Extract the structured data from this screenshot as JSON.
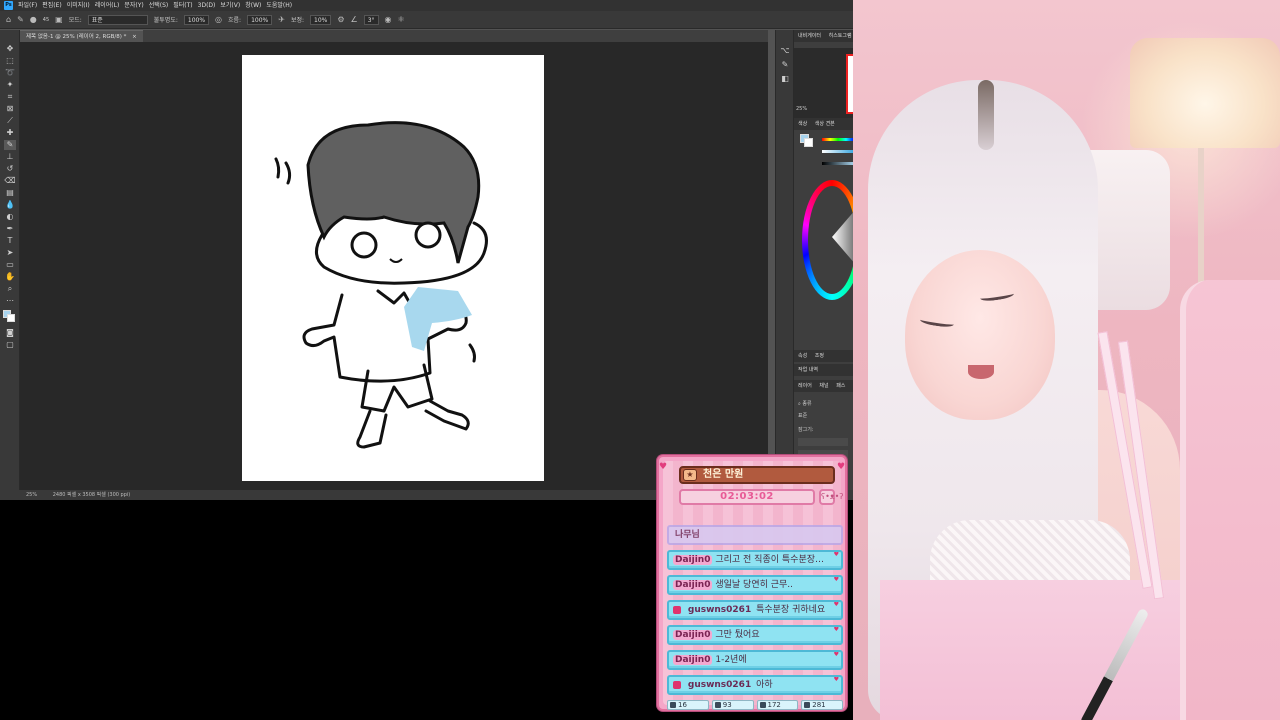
{
  "photoshop": {
    "menu": [
      "파일(F)",
      "편집(E)",
      "이미지(I)",
      "레이어(L)",
      "문자(Y)",
      "선택(S)",
      "필터(T)",
      "3D(D)",
      "보기(V)",
      "창(W)",
      "도움말(H)"
    ],
    "options": {
      "brush_size": "45",
      "mode_label": "모드:",
      "mode_value": "표준",
      "opacity_label": "불투명도:",
      "opacity_value": "100%",
      "flow_label": "흐름:",
      "flow_value": "100%",
      "smoothing_label": "보정:",
      "smoothing_value": "10%",
      "angle_value": "3°"
    },
    "document_tab": "제목 없음-1 @ 25% (레이어 2, RGB/8) *",
    "status": {
      "zoom": "25%",
      "size": "2480 픽셀 x 3508 픽셀 (300 ppi)"
    },
    "panels": {
      "top_tabs": [
        "내비게이터",
        "히스토그램"
      ],
      "zoom": "25%",
      "color_tabs": [
        "색상",
        "색상 견본"
      ],
      "props_tabs": [
        "속성",
        "조정"
      ],
      "history_tab": "작업 내역",
      "layers_tabs": [
        "레이어",
        "채널",
        "패스"
      ],
      "filter_kind": "종류",
      "blend_mode": "표준",
      "lock_label": "잠그기:"
    }
  },
  "chat": {
    "title": "천은 만원",
    "timer": "02:03:02",
    "messages": [
      {
        "nick": "나무님",
        "text": "",
        "faded": true
      },
      {
        "nick": "Daijin0",
        "text": "그리고 전 직종이 특수분장…",
        "faded": false,
        "icon": false
      },
      {
        "nick": "Daijin0",
        "text": "생일날 당연히 근무..",
        "faded": false,
        "icon": false
      },
      {
        "nick": "guswns0261",
        "text": "특수분장 귀하네요",
        "faded": false,
        "icon": true
      },
      {
        "nick": "Daijin0",
        "text": "그만 뒀어요",
        "faded": false,
        "icon": false
      },
      {
        "nick": "Daijin0",
        "text": "1-2년에",
        "faded": false,
        "icon": false
      },
      {
        "nick": "guswns0261",
        "text": "아하",
        "faded": false,
        "icon": true
      }
    ],
    "stats": [
      "16",
      "93",
      "172",
      "281"
    ]
  },
  "colors": {
    "ps_bg": "#535353",
    "chat_border": "#e2709e",
    "msg_bg": "#8fe3f2",
    "drawing_fill_blue": "#a8d8ee"
  }
}
